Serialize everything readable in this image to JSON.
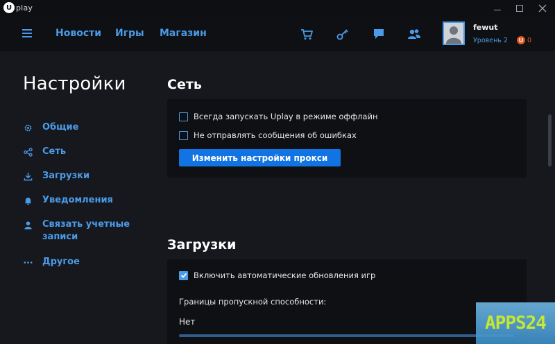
{
  "app": {
    "logo_letter": "U",
    "logo_text": "play"
  },
  "nav": {
    "links": [
      "Новости",
      "Игры",
      "Магазин"
    ],
    "icons": [
      "cart-icon",
      "key-icon",
      "chat-icon",
      "friends-icon"
    ]
  },
  "user": {
    "name": "fewut",
    "level": "Уровень 2",
    "coin_letter": "U",
    "coins": "0"
  },
  "sidebar": {
    "title": "Настройки",
    "items": [
      {
        "label": "Общие",
        "icon": "gear-icon"
      },
      {
        "label": "Сеть",
        "icon": "network-icon"
      },
      {
        "label": "Загрузки",
        "icon": "download-icon"
      },
      {
        "label": "Уведомления",
        "icon": "bell-icon"
      },
      {
        "label": "Связать учетные записи",
        "icon": "user-icon"
      },
      {
        "label": "Другое",
        "icon": "more-icon"
      }
    ]
  },
  "network": {
    "title": "Сеть",
    "offline_label": "Всегда запускать Uplay в режиме оффлайн",
    "offline_checked": false,
    "errors_label": "Не отправлять сообщения об ошибках",
    "errors_checked": false,
    "proxy_button": "Изменить настройки прокси"
  },
  "downloads": {
    "title": "Загрузки",
    "autoupdate_label": "Включить автоматические обновления игр",
    "autoupdate_checked": true,
    "bandwidth_label": "Границы пропускной способности:",
    "bandwidth_value": "Нет"
  },
  "watermark": "APPS24",
  "colors": {
    "accent": "#4a9be8",
    "button": "#1273e3",
    "background": "#16181d",
    "panel": "#0f1014",
    "coin": "#e0561f"
  }
}
